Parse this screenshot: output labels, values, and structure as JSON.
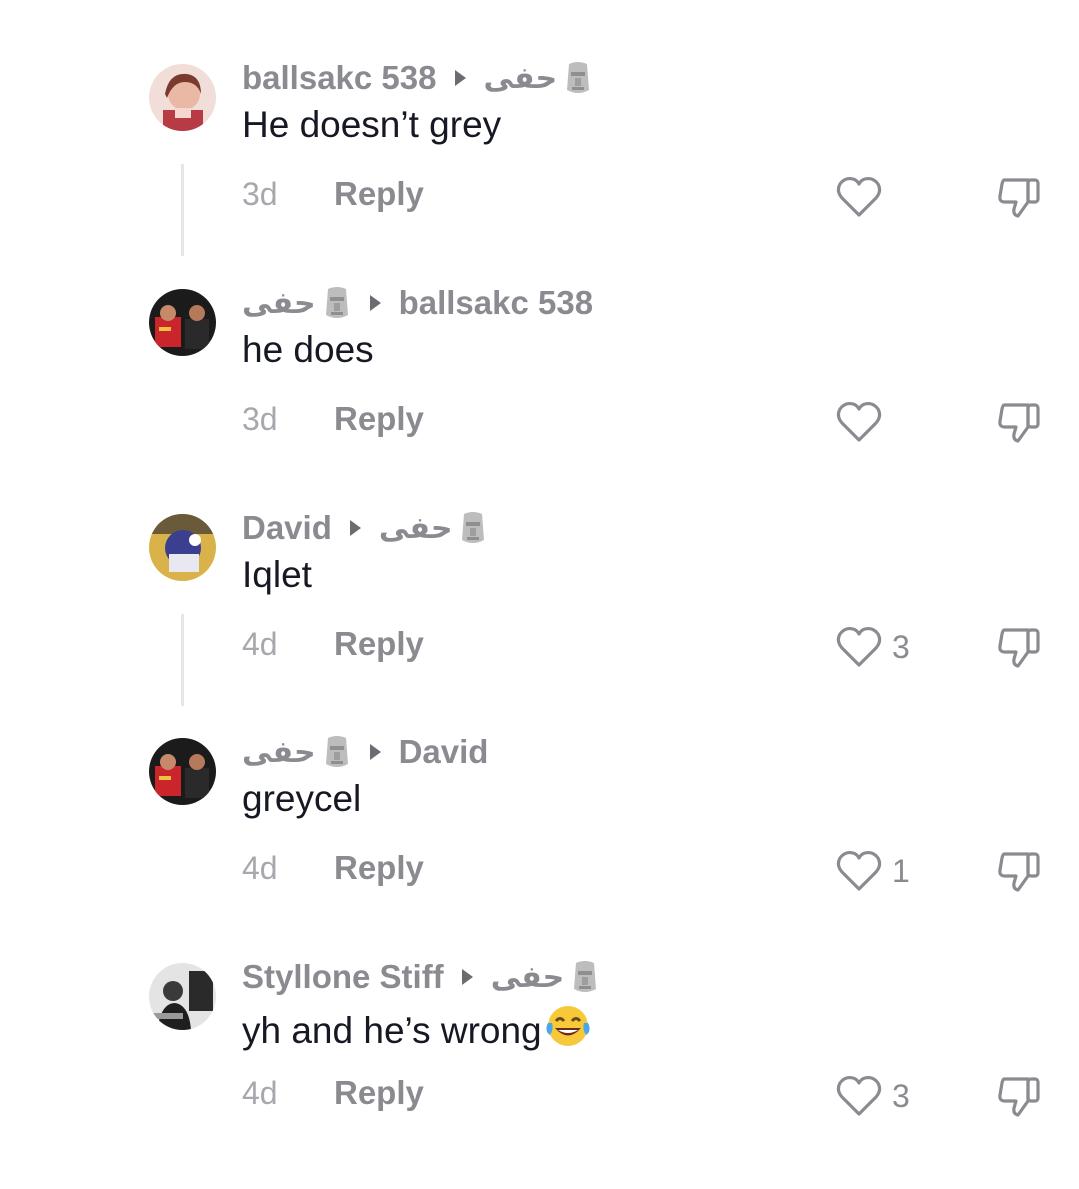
{
  "comments": [
    {
      "author": "ballsakc 538",
      "reply_to": "حفى",
      "text": "He doesn’t grey",
      "time": "3d",
      "reply_label": "Reply",
      "likes": ""
    },
    {
      "author": "حفى",
      "reply_to": "ballsakc 538",
      "text": "he does",
      "time": "3d",
      "reply_label": "Reply",
      "likes": ""
    },
    {
      "author": "David",
      "reply_to": "حفى",
      "text": "Iqlet",
      "time": "4d",
      "reply_label": "Reply",
      "likes": "3"
    },
    {
      "author": "حفى",
      "reply_to": "David",
      "text": "greycel",
      "time": "4d",
      "reply_label": "Reply",
      "likes": "1"
    },
    {
      "author": "Styllone Stiff",
      "reply_to": "حفى",
      "text": "yh and he’s wrong",
      "time": "4d",
      "reply_label": "Reply",
      "likes": "3"
    }
  ],
  "icons": {
    "like": "heart-outline-icon",
    "dislike": "thumbs-down-icon",
    "moai": "moai-emoji-icon",
    "laugh": "tears-of-joy-emoji-icon"
  },
  "colors": {
    "text": "#161823",
    "secondary": "#8a8b91",
    "timestamp": "#a7a8ad",
    "thread_line": "#e6e6e6"
  }
}
